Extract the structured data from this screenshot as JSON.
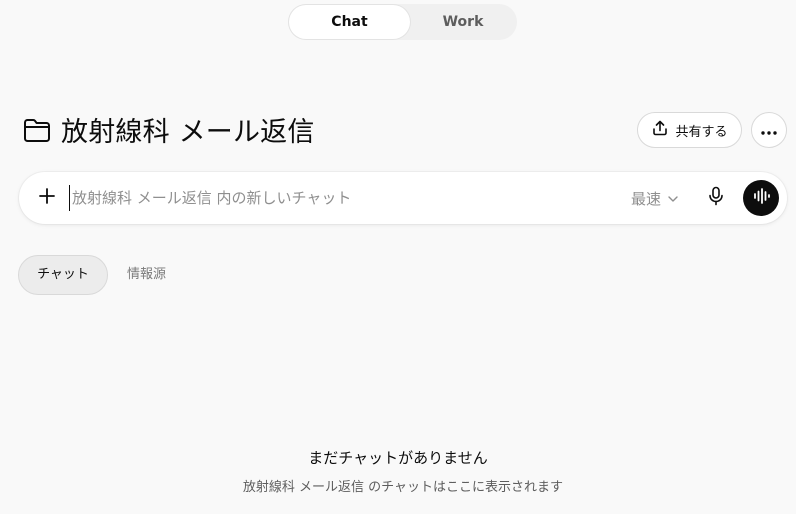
{
  "mode_toggle": {
    "chat_label": "Chat",
    "work_label": "Work"
  },
  "header": {
    "folder_icon": "folder-icon",
    "title": "放射線科 メール返信",
    "share_label": "共有する",
    "share_icon": "share-upload-icon",
    "more_icon": "more-horizontal-icon"
  },
  "composer": {
    "placeholder": "放射線科 メール返信 内の新しいチャット",
    "value": "",
    "plus_icon": "plus-icon",
    "model_label": "最速",
    "model_icon": "chevron-down-icon",
    "mic_icon": "microphone-icon",
    "voice_icon": "voice-waveform-icon"
  },
  "tabs": [
    {
      "label": "チャット",
      "active": true
    },
    {
      "label": "情報源",
      "active": false
    }
  ],
  "empty_state": {
    "title": "まだチャットがありません",
    "description": "放射線科 メール返信 のチャットはここに表示されます"
  },
  "colors": {
    "background": "#f9f9f9",
    "text": "#0d0d0d",
    "muted": "#8f8f8f",
    "voice_button": "#0d0d0d",
    "border": "#d9d9d9"
  }
}
